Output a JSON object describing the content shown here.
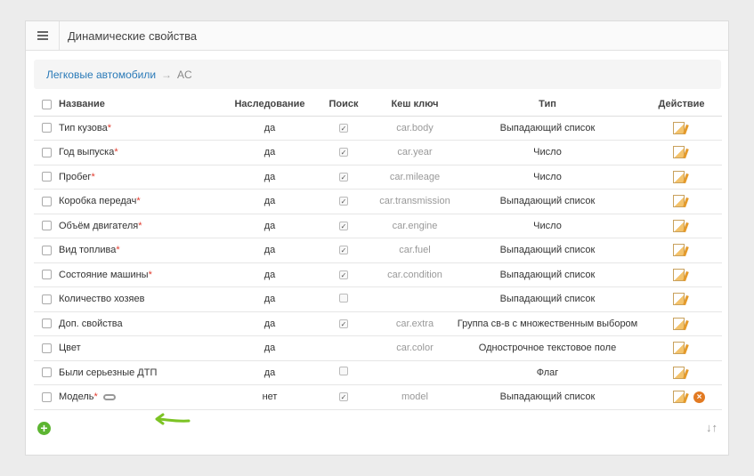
{
  "header": {
    "title": "Динамические свойства",
    "menu_icon": "hamburger-icon"
  },
  "breadcrumb": {
    "parent": "Легковые автомобили",
    "separator": "→",
    "current": "AC"
  },
  "columns": {
    "name": "Название",
    "inherit": "Наследование",
    "search": "Поиск",
    "key": "Кеш ключ",
    "type": "Тип",
    "action": "Действие"
  },
  "rows": [
    {
      "name": "Тип кузова",
      "required": "*",
      "inherit": "да",
      "search": "checked",
      "key": "car.body",
      "type": "Выпадающий список"
    },
    {
      "name": "Год выпуска",
      "required": "*",
      "inherit": "да",
      "search": "checked",
      "key": "car.year",
      "type": "Число"
    },
    {
      "name": "Пробег",
      "required": "*",
      "inherit": "да",
      "search": "checked",
      "key": "car.mileage",
      "type": "Число"
    },
    {
      "name": "Коробка передач",
      "required": "*",
      "inherit": "да",
      "search": "checked",
      "key": "car.transmission",
      "type": "Выпадающий список"
    },
    {
      "name": "Объём двигателя",
      "required": "*",
      "inherit": "да",
      "search": "checked",
      "key": "car.engine",
      "type": "Число"
    },
    {
      "name": "Вид топлива",
      "required": "*",
      "inherit": "да",
      "search": "checked",
      "key": "car.fuel",
      "type": "Выпадающий список"
    },
    {
      "name": "Состояние машины",
      "required": "*",
      "inherit": "да",
      "search": "checked",
      "key": "car.condition",
      "type": "Выпадающий список"
    },
    {
      "name": "Количество хозяев",
      "required": "",
      "inherit": "да",
      "search": "unchecked",
      "key": "",
      "type": "Выпадающий список"
    },
    {
      "name": "Доп. свойства",
      "required": "",
      "inherit": "да",
      "search": "checked",
      "key": "car.extra",
      "type": "Группа св-в с множественным выбором"
    },
    {
      "name": "Цвет",
      "required": "",
      "inherit": "да",
      "search": "none",
      "key": "car.color",
      "type": "Однострочное текстовое поле"
    },
    {
      "name": "Были серьезные ДТП",
      "required": "",
      "inherit": "да",
      "search": "unchecked",
      "key": "",
      "type": "Флаг"
    },
    {
      "name": "Модель",
      "required": "*",
      "inherit": "нет",
      "search": "checked",
      "key": "model",
      "type": "Выпадающий список",
      "link": true,
      "deletable": true
    }
  ],
  "footer": {
    "add_icon": "plus-circle-icon",
    "sort_label": "↓↑"
  },
  "colors": {
    "link": "#2a7ab8",
    "required": "#e23b2e",
    "add": "#5cb531",
    "delete": "#e27a22",
    "arrow": "#7cc324"
  }
}
